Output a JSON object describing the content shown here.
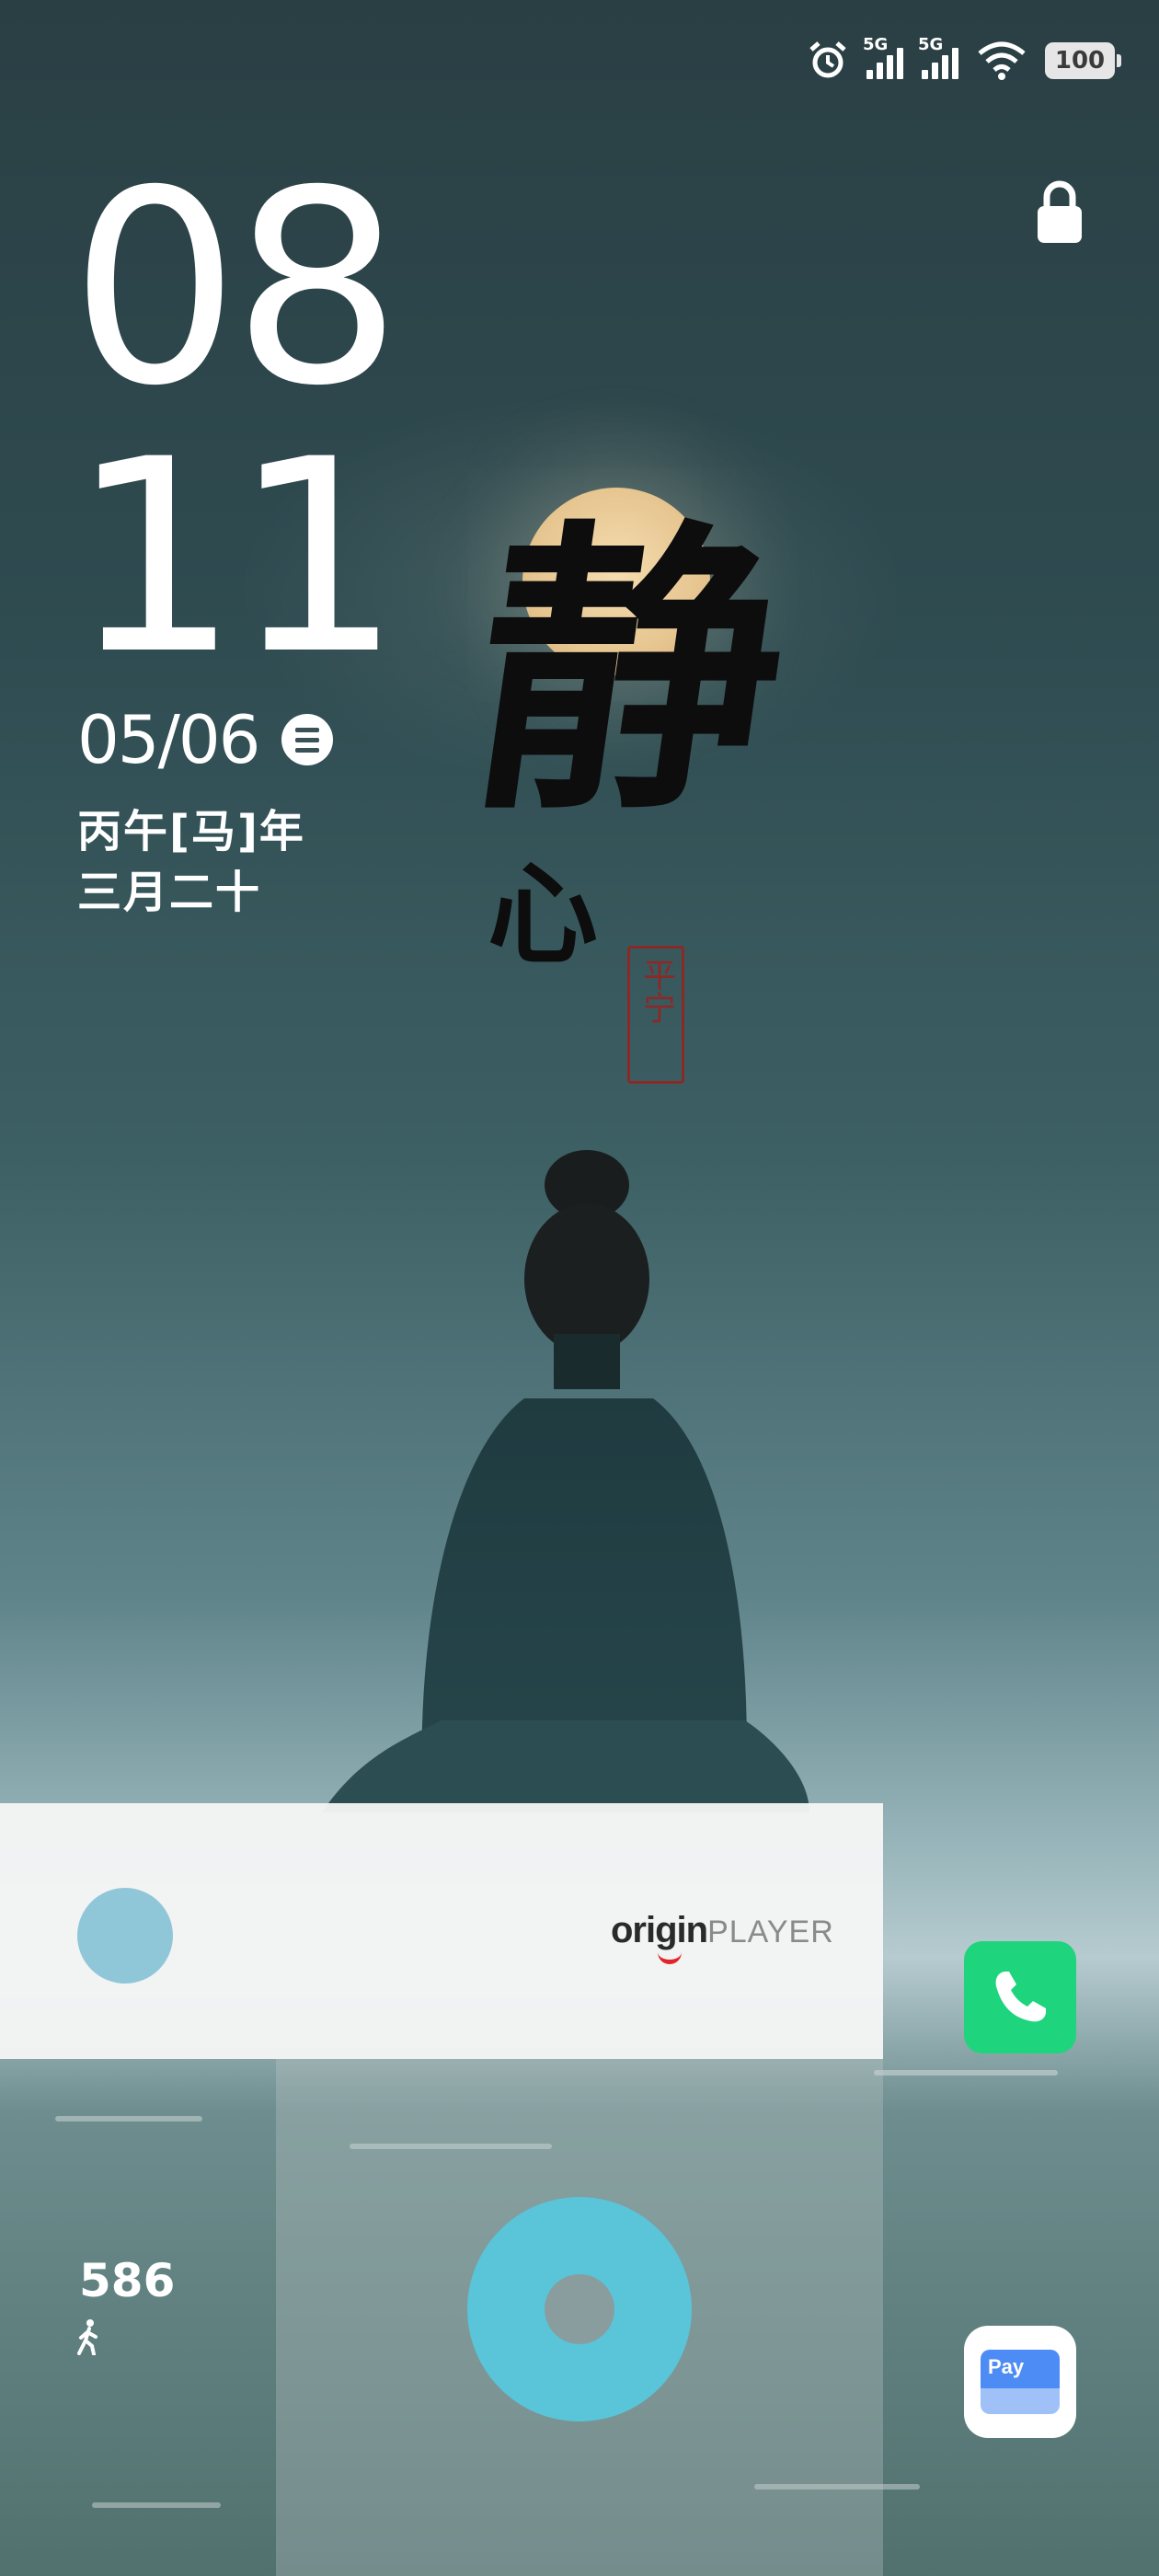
{
  "status_bar": {
    "alarm_icon": "alarm-clock-icon",
    "sim1": "5G",
    "sim2": "5G",
    "wifi_icon": "wifi-icon",
    "battery": "100"
  },
  "clock": {
    "hours": "08",
    "minutes": "11"
  },
  "date": {
    "day": "05/06",
    "menu_icon": "list-icon"
  },
  "lunar": {
    "line1": "丙午[马]年",
    "line2": "三月二十"
  },
  "lock_icon": "lock-icon",
  "wallpaper": {
    "calligraphy_main": "静",
    "calligraphy_sub": "心",
    "seal_text": "平宁"
  },
  "player": {
    "brand_prefix": "origin",
    "brand_suffix": "PLAYER"
  },
  "steps": {
    "count": "586",
    "icon": "walking-person-icon"
  },
  "shortcuts": {
    "phone_icon": "phone-icon",
    "pay_icon": "wallet-pay-icon",
    "pay_label": "Pay"
  },
  "colors": {
    "phone_green": "#1ed47d",
    "ring_cyan": "#5ac4d8",
    "pay_blue": "#4e8cf5"
  }
}
